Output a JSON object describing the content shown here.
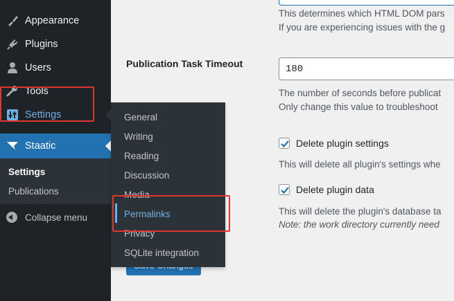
{
  "sidebar": {
    "items": [
      {
        "label": "Appearance",
        "icon": "paintbrush-icon"
      },
      {
        "label": "Plugins",
        "icon": "plugin-icon"
      },
      {
        "label": "Users",
        "icon": "user-icon"
      },
      {
        "label": "Tools",
        "icon": "wrench-icon"
      },
      {
        "label": "Settings",
        "icon": "settings-sliders-icon"
      },
      {
        "label": "Staatic",
        "icon": "staatic-bird-icon"
      }
    ],
    "staatic_submenu": [
      "Settings",
      "Publications"
    ],
    "collapse_label": "Collapse menu"
  },
  "flyout": {
    "items": [
      "General",
      "Writing",
      "Reading",
      "Discussion",
      "Media",
      "Permalinks",
      "Privacy",
      "SQLite integration"
    ]
  },
  "main": {
    "desc_top_1": "This determines which HTML DOM pars",
    "desc_top_2": "If you are experiencing issues with the g",
    "timeout_label": "Publication Task Timeout",
    "timeout_value": "180",
    "timeout_desc_1": "The number of seconds before publicat",
    "timeout_desc_2": "Only change this value to troubleshoot",
    "delete_settings_label": "Delete plugin settings",
    "delete_settings_desc": "This will delete all plugin's settings whe",
    "delete_data_label": "Delete plugin data",
    "delete_data_desc_1": "This will delete the plugin's database ta",
    "delete_data_desc_2": "Note: the work directory currently need",
    "save_label": "Save Changes"
  },
  "colors": {
    "sidebar_bg": "#1d2327",
    "active_blue": "#2271b1",
    "highlight_text": "#72aee6",
    "annotation_red": "#e2362c"
  }
}
